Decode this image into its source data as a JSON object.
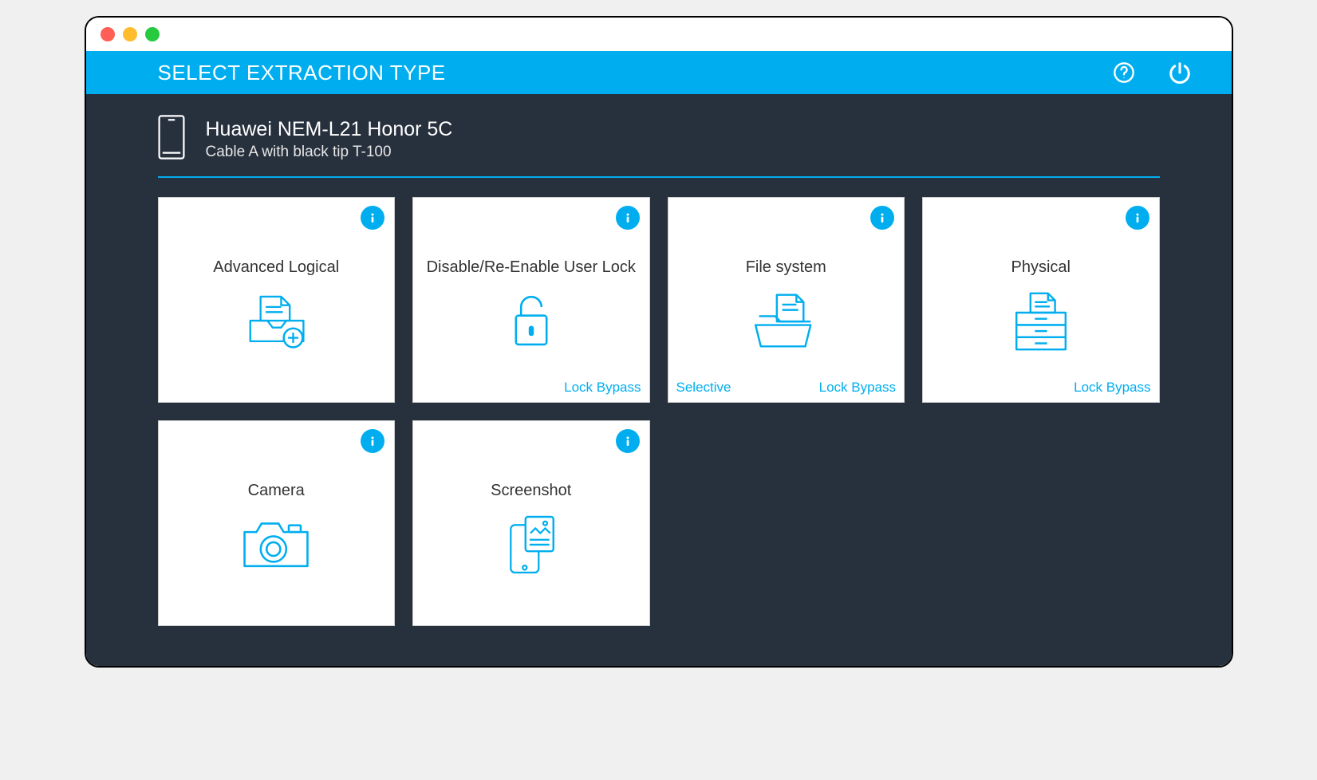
{
  "header": {
    "title": "SELECT EXTRACTION TYPE"
  },
  "device": {
    "name": "Huawei NEM-L21 Honor 5C",
    "cable": "Cable A with black tip T-100"
  },
  "tiles": [
    {
      "title": "Advanced Logical",
      "left": "",
      "right": ""
    },
    {
      "title": "Disable/Re-Enable User Lock",
      "left": "",
      "right": "Lock Bypass"
    },
    {
      "title": "File system",
      "left": "Selective",
      "right": "Lock Bypass"
    },
    {
      "title": "Physical",
      "left": "",
      "right": "Lock Bypass"
    },
    {
      "title": "Camera",
      "left": "",
      "right": ""
    },
    {
      "title": "Screenshot",
      "left": "",
      "right": ""
    }
  ]
}
